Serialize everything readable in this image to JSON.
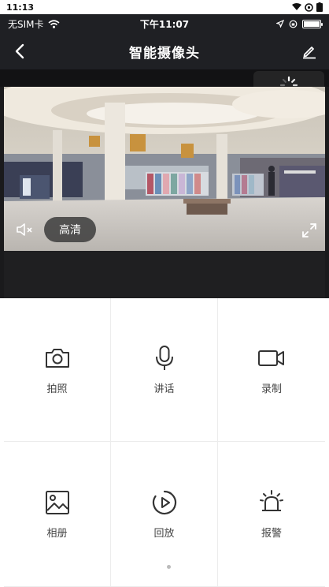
{
  "system_bar": {
    "time": "11:13"
  },
  "status_bar": {
    "carrier": "无SIM卡",
    "time": "下午11:07"
  },
  "header": {
    "title": "智能摄像头"
  },
  "player": {
    "quality_label": "高清"
  },
  "actions": [
    {
      "label": "拍照",
      "icon": "camera-icon"
    },
    {
      "label": "讲话",
      "icon": "microphone-icon"
    },
    {
      "label": "录制",
      "icon": "video-record-icon"
    },
    {
      "label": "相册",
      "icon": "album-icon"
    },
    {
      "label": "回放",
      "icon": "playback-icon"
    },
    {
      "label": "报警",
      "icon": "alarm-icon"
    }
  ]
}
